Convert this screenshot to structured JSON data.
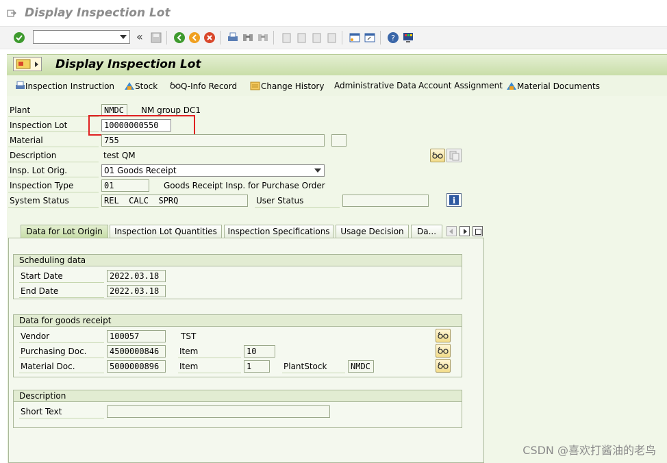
{
  "window": {
    "title": "Display Inspection Lot"
  },
  "toolbar": {
    "command_field_value": ""
  },
  "screen": {
    "title": "Display Inspection Lot"
  },
  "app_toolbar": {
    "items": [
      {
        "label": "Inspection Instruction",
        "icon": "printer-icon"
      },
      {
        "label": "Stock",
        "icon": "stock-icon"
      },
      {
        "label": "Q-Info Record",
        "icon": "glasses-icon"
      },
      {
        "label": "Change History",
        "icon": "history-icon"
      },
      {
        "label": "Administrative Data",
        "icon": ""
      },
      {
        "label": "Account Assignment",
        "icon": ""
      },
      {
        "label": "Material Documents",
        "icon": "stock-icon"
      }
    ]
  },
  "header": {
    "plant_label": "Plant",
    "plant_value": "NMDC",
    "plant_text": "NM group DC1",
    "lot_label": "Inspection Lot",
    "lot_value": "10000000550",
    "material_label": "Material",
    "material_value": "755",
    "description_label": "Description",
    "description_value": "test QM",
    "origin_label": "Insp. Lot Orig.",
    "origin_value": "01 Goods Receipt",
    "type_label": "Inspection Type",
    "type_value": "01",
    "type_text": "Goods Receipt Insp. for Purchase Order",
    "system_status_label": "System Status",
    "system_status_value": "REL  CALC  SPRQ",
    "user_status_label": "User Status",
    "user_status_value": ""
  },
  "tabs": [
    {
      "label": "Data for Lot Origin",
      "active": true
    },
    {
      "label": "Inspection Lot Quantities",
      "active": false
    },
    {
      "label": "Inspection Specifications",
      "active": false
    },
    {
      "label": "Usage Decision",
      "active": false
    },
    {
      "label": "Da...",
      "active": false
    }
  ],
  "scheduling": {
    "title": "Scheduling data",
    "start_label": "Start Date",
    "start_value": "2022.03.18",
    "end_label": "End Date",
    "end_value": "2022.03.18"
  },
  "goods_receipt": {
    "title": "Data for goods receipt",
    "vendor_label": "Vendor",
    "vendor_value": "100057",
    "vendor_text": "TST",
    "po_label": "Purchasing Doc.",
    "po_value": "4500000846",
    "po_item_label": "Item",
    "po_item_value": "10",
    "matdoc_label": "Material Doc.",
    "matdoc_value": "5000000896",
    "matdoc_item_label": "Item",
    "matdoc_item_value": "1",
    "plantstock_label": "PlantStock",
    "plantstock_value": "NMDC"
  },
  "description_group": {
    "title": "Description",
    "short_text_label": "Short Text",
    "short_text_value": ""
  },
  "watermark": "CSDN @喜欢打酱油的老鸟",
  "colors": {
    "highlight": "#e02020",
    "header_green": "#c9dea9",
    "panel": "#f1f7e8"
  }
}
